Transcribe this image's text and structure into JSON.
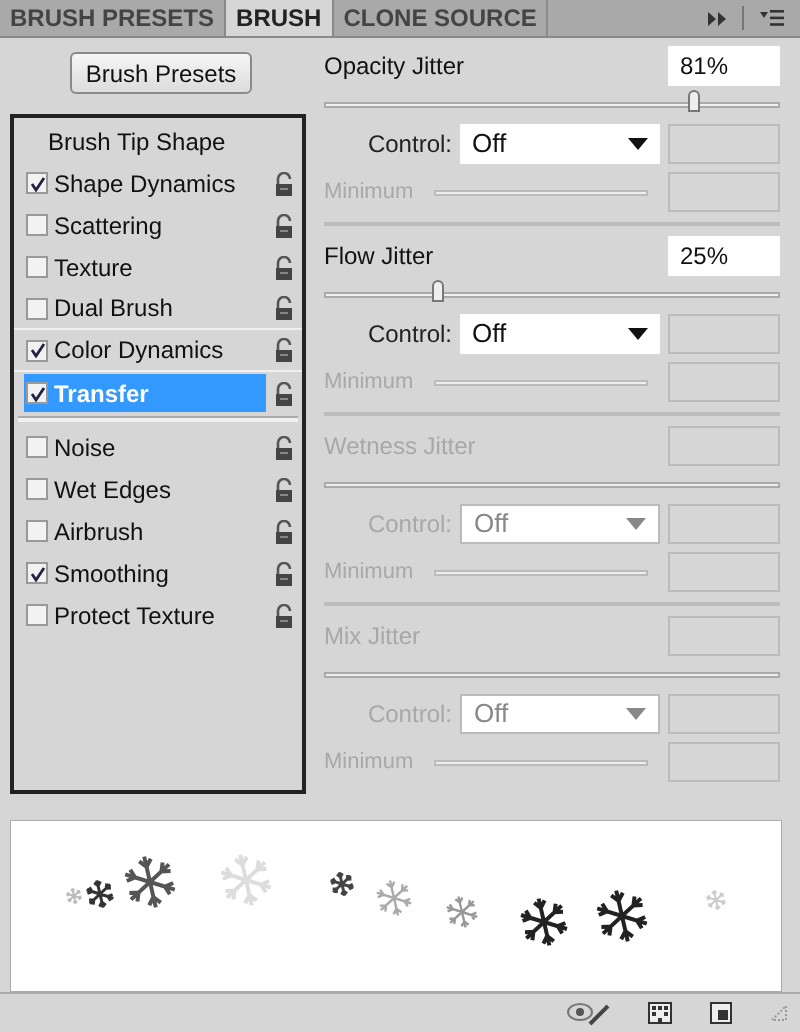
{
  "tabs": [
    {
      "label": "BRUSH PRESETS",
      "selected": false
    },
    {
      "label": "BRUSH",
      "selected": true
    },
    {
      "label": "CLONE SOURCE",
      "selected": false
    }
  ],
  "brush_presets_button": "Brush Presets",
  "brush_settings": [
    {
      "kind": "header",
      "label": "Brush Tip Shape"
    },
    {
      "kind": "option",
      "label": "Shape Dynamics",
      "checked": true,
      "selected": false
    },
    {
      "kind": "option",
      "label": "Scattering",
      "checked": false,
      "selected": false
    },
    {
      "kind": "option",
      "label": "Texture",
      "checked": false,
      "selected": false
    },
    {
      "kind": "option",
      "label": "Dual Brush",
      "checked": false,
      "selected": false
    },
    {
      "kind": "option",
      "label": "Color Dynamics",
      "checked": true,
      "selected": false
    },
    {
      "kind": "option",
      "label": "Transfer",
      "checked": true,
      "selected": true
    }
  ],
  "other_settings": [
    {
      "label": "Noise",
      "checked": false,
      "selected": false
    },
    {
      "label": "Wet Edges",
      "checked": false,
      "selected": false
    },
    {
      "label": "Airbrush",
      "checked": false,
      "selected": false
    },
    {
      "label": "Smoothing",
      "checked": true,
      "selected": false
    },
    {
      "label": "Protect Texture",
      "checked": false,
      "selected": false
    }
  ],
  "jitters": [
    {
      "label": "Opacity Jitter",
      "value": "81%",
      "level": 0.81,
      "disabled": false,
      "control_label": "Control:",
      "control": "Off",
      "minimum_label": "Minimum"
    },
    {
      "label": "Flow Jitter",
      "value": "25%",
      "level": 0.25,
      "disabled": false,
      "control_label": "Control:",
      "control": "Off",
      "minimum_label": "Minimum"
    },
    {
      "label": "Wetness Jitter",
      "disabled": true,
      "control_label": "Control:",
      "control": "Off",
      "minimum_label": "Minimum"
    },
    {
      "label": "Mix Jitter",
      "disabled": true,
      "control_label": "Control:",
      "control": "Off",
      "minimum_label": "Minimum"
    }
  ]
}
